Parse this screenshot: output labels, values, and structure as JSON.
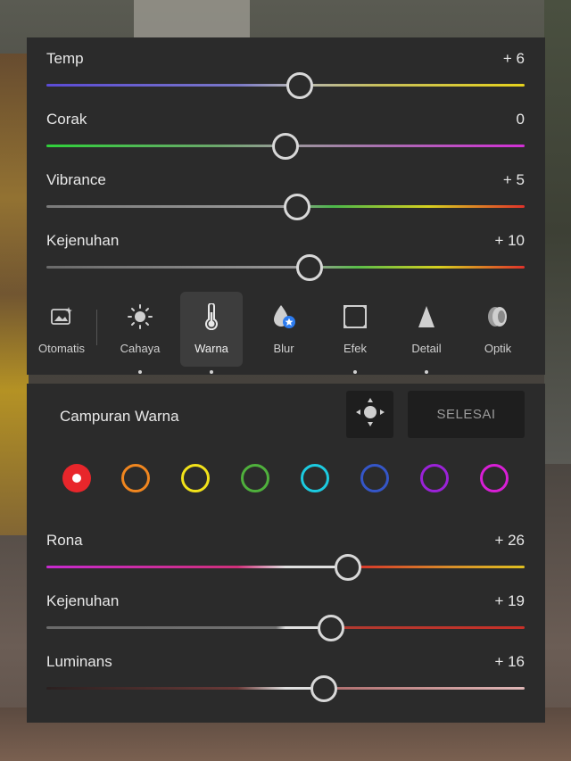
{
  "basic_sliders": [
    {
      "label": "Temp",
      "value": "+ 6",
      "level": 0.53
    },
    {
      "label": "Corak",
      "value": "0",
      "level": 0.5
    },
    {
      "label": "Vibrance",
      "value": "+ 5",
      "level": 0.525
    },
    {
      "label": "Kejenuhan",
      "value": "+ 10",
      "level": 0.55
    }
  ],
  "tools": [
    {
      "label": "Otomatis",
      "icon": "auto-image-icon"
    },
    {
      "label": "Cahaya",
      "icon": "sun-icon"
    },
    {
      "label": "Warna",
      "icon": "thermometer-icon",
      "active": true
    },
    {
      "label": "Blur",
      "icon": "drop-icon"
    },
    {
      "label": "Efek",
      "icon": "vignette-icon"
    },
    {
      "label": "Detail",
      "icon": "triangle-icon"
    },
    {
      "label": "Optik",
      "icon": "lens-icon"
    }
  ],
  "color_mix": {
    "title": "Campuran Warna",
    "done_label": "SELESAI",
    "swatches": [
      {
        "name": "red",
        "color": "#e8262b",
        "selected": true
      },
      {
        "name": "orange",
        "color": "#f0861f"
      },
      {
        "name": "yellow",
        "color": "#f2e21a"
      },
      {
        "name": "green",
        "color": "#4fb03c"
      },
      {
        "name": "aqua",
        "color": "#1ccbe0"
      },
      {
        "name": "blue",
        "color": "#3556c8"
      },
      {
        "name": "purple",
        "color": "#9b22d8"
      },
      {
        "name": "magenta",
        "color": "#d81fd6"
      }
    ],
    "sliders": [
      {
        "label": "Rona",
        "value": "+ 26",
        "level": 0.63
      },
      {
        "label": "Kejenuhan",
        "value": "+ 19",
        "level": 0.595
      },
      {
        "label": "Luminans",
        "value": "+ 16",
        "level": 0.58
      }
    ]
  },
  "colors": {
    "panel": "#2b2b2b",
    "knob": "#d8d8d8"
  }
}
